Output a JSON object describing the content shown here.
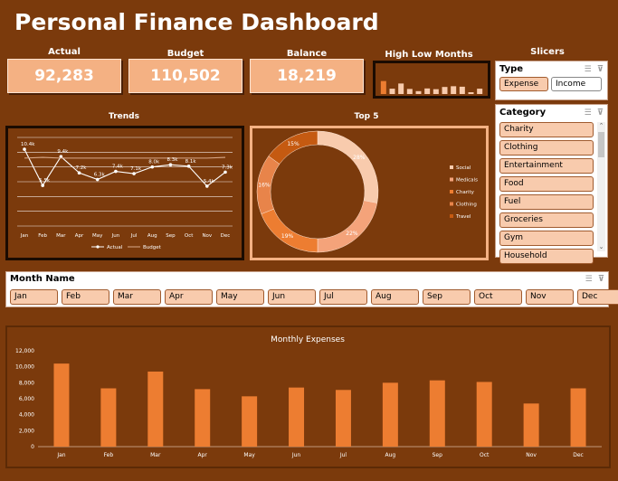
{
  "title": "Personal Finance Dashboard",
  "kpis": {
    "actual": {
      "label": "Actual",
      "value": "92,283"
    },
    "budget": {
      "label": "Budget",
      "value": "110,502"
    },
    "balance": {
      "label": "Balance",
      "value": "18,219"
    }
  },
  "high_low_title": "High Low Months",
  "slicers_title": "Slicers",
  "type_slicer": {
    "title": "Type",
    "options": [
      "Expense",
      "Income"
    ],
    "selected": "Expense"
  },
  "category_slicer": {
    "title": "Category",
    "items": [
      "Charity",
      "Clothing",
      "Entertainment",
      "Food",
      "Fuel",
      "Groceries",
      "Gym",
      "Household"
    ]
  },
  "month_slicer": {
    "title": "Month Name",
    "items": [
      "Jan",
      "Feb",
      "Mar",
      "Apr",
      "May",
      "Jun",
      "Jul",
      "Aug",
      "Sep",
      "Oct",
      "Nov",
      "Dec"
    ]
  },
  "colors": {
    "background": "#7b3a0c",
    "accent": "#ed7d31",
    "light": "#f4b183"
  },
  "chart_data": [
    {
      "id": "trends",
      "type": "line",
      "title": "Trends",
      "categories": [
        "Jan",
        "Feb",
        "Mar",
        "Apr",
        "May",
        "Jun",
        "Jul",
        "Aug",
        "Sep",
        "Oct",
        "Nov",
        "Dec"
      ],
      "series": [
        {
          "name": "Actual",
          "values": [
            10.4,
            5.5,
            9.4,
            7.2,
            6.3,
            7.4,
            7.1,
            8.0,
            8.3,
            8.1,
            5.4,
            7.3
          ]
        },
        {
          "name": "Budget",
          "values": [
            9.2,
            9.3,
            9.2,
            9.2,
            9.2,
            9.2,
            9.2,
            9.2,
            9.2,
            9.2,
            9.2,
            9.3
          ]
        }
      ],
      "data_labels": [
        "10.4k",
        "5.5k",
        "9.4k",
        "7.2k",
        "6.3k",
        "7.4k",
        "7.1k",
        "8.0k",
        "8.3k",
        "8.1k",
        "5.4k",
        "7.3k"
      ],
      "ylim": [
        0,
        12
      ],
      "grid": true,
      "legend": "bottom"
    },
    {
      "id": "top5",
      "type": "pie",
      "title": "Top 5",
      "labels": [
        "Social",
        "Medicals",
        "Charity",
        "Clothing",
        "Travel"
      ],
      "values": [
        28,
        22,
        19,
        16,
        15
      ],
      "data_labels": [
        "28%",
        "22%",
        "19%",
        "16%",
        "15%"
      ],
      "colors": [
        "#f8cbad",
        "#f4a37a",
        "#ed7d31",
        "#e8844a",
        "#c55a11"
      ],
      "legend": "right"
    },
    {
      "id": "high_low",
      "type": "bar",
      "categories": [
        "Jan",
        "Feb",
        "Mar",
        "Apr",
        "May",
        "Jun",
        "Jul",
        "Aug",
        "Sep",
        "Oct",
        "Nov",
        "Dec"
      ],
      "values": [
        10.4,
        7.3,
        9.4,
        7.2,
        6.3,
        7.4,
        7.1,
        8.0,
        8.3,
        8.1,
        5.4,
        7.3
      ],
      "ylim": [
        0,
        11
      ]
    },
    {
      "id": "monthly_expenses",
      "type": "bar",
      "title": "Monthly Expenses",
      "categories": [
        "Jan",
        "Feb",
        "Mar",
        "Apr",
        "May",
        "Jun",
        "Jul",
        "Aug",
        "Sep",
        "Oct",
        "Nov",
        "Dec"
      ],
      "values": [
        10400,
        7300,
        9400,
        7200,
        6300,
        7400,
        7100,
        8000,
        8300,
        8100,
        5400,
        7300
      ],
      "yticks": [
        "0",
        "2,000",
        "4,000",
        "6,000",
        "8,000",
        "10,000",
        "12,000"
      ],
      "ylim": [
        0,
        12000
      ],
      "grid": false
    }
  ]
}
